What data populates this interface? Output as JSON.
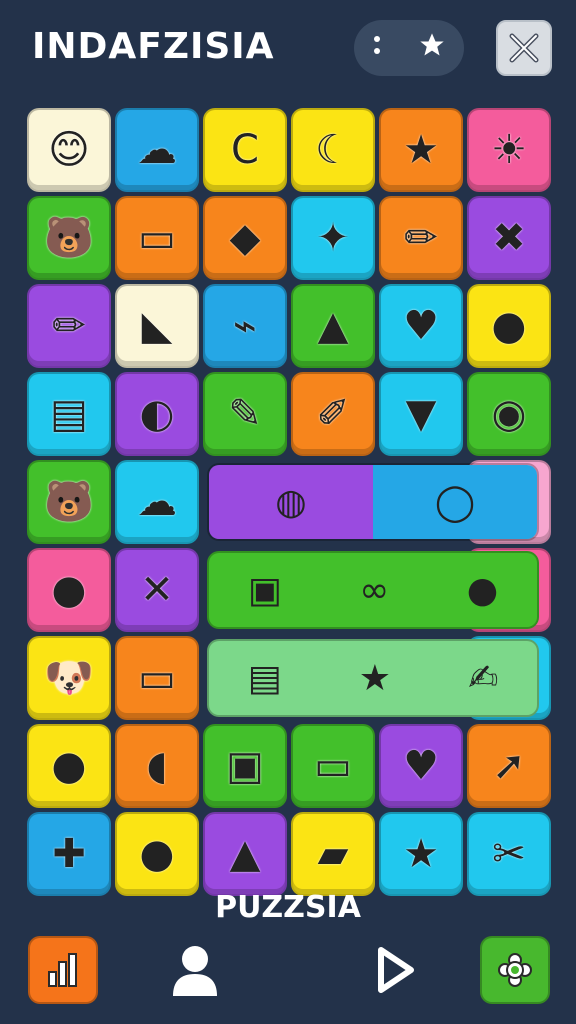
{
  "header": {
    "title": "INDAFZISIA",
    "menu_icon": "more-vertical-icon",
    "star_icon": "star-icon",
    "close_icon": "close-icon"
  },
  "board": {
    "colors": {
      "cream": "#fbf6d8",
      "blue": "#25a7e6",
      "yellow": "#fbe414",
      "orange": "#f7851c",
      "pink": "#f45c9c",
      "green": "#43c02b",
      "purple": "#9a4be0",
      "cyan": "#21c8ee",
      "lightpink": "#f7a6cf",
      "lightgreen": "#7cd88a"
    },
    "tiles": [
      [
        "star-face-icon",
        "cloud-creature-icon",
        "c-hook-icon",
        "crescent-moon-icon",
        "purple-bag-icon",
        "sun-gear-icon"
      ],
      [
        "bear-icon",
        "tablet-icon",
        "box-icon",
        "sun-icon",
        "pencil-icon",
        "tool-kit-icon"
      ],
      [
        "crayon-icon",
        "pink-fish-icon",
        "lighter-icon",
        "slime-icon",
        "speech-heart-icon",
        "bear-face-icon"
      ],
      [
        "trash-can-icon",
        "green-creature-icon",
        "blue-marker-icon",
        "paint-brush-icon",
        "yellow-kite-icon",
        "spiral-icon"
      ],
      [
        "yellow-bear-icon",
        "cloud-face-icon",
        "",
        "",
        "",
        "green-cat-icon"
      ],
      [
        "cookie-icon",
        "crossed-sticks-icon",
        "",
        "",
        "",
        "pencil-icon"
      ],
      [
        "yellow-dog-icon",
        "gamepad-icon",
        "",
        "",
        "",
        "ice-pop-icon"
      ],
      [
        "seal-icon",
        "radish-icon",
        "jar-icon",
        "cake-icon",
        "heart-balloon-icon",
        "comet-icon"
      ],
      [
        "broccoli-icon",
        "red-balloon-icon",
        "rocket-icon",
        "book-icon",
        "star-creature-icon",
        "scissors-icon"
      ]
    ],
    "tile_glyphs": [
      [
        "😊",
        "☁",
        "C",
        "☾",
        "★",
        "☀"
      ],
      [
        "🐻",
        "▭",
        "◆",
        "✦",
        "✏",
        "✖"
      ],
      [
        "✏",
        "◣",
        "⌁",
        "▲",
        "♥",
        "●"
      ],
      [
        "▤",
        "◐",
        "✎",
        "✐",
        "▼",
        "◉"
      ],
      [
        "🐻",
        "☁",
        "",
        "",
        "",
        "●"
      ],
      [
        "●",
        "✕",
        "",
        "",
        "",
        "✏"
      ],
      [
        "🐶",
        "▭",
        "",
        "",
        "",
        "▲"
      ],
      [
        "●",
        "◖",
        "▣",
        "▭",
        "♥",
        "➚"
      ],
      [
        "✚",
        "●",
        "▲",
        "▰",
        "★",
        "✂"
      ]
    ],
    "tile_colors": [
      [
        "cream",
        "blue",
        "yellow",
        "yellow",
        "orange",
        "pink"
      ],
      [
        "green",
        "orange",
        "orange",
        "cyan",
        "orange",
        "purple"
      ],
      [
        "purple",
        "cream",
        "blue",
        "green",
        "cyan",
        "yellow"
      ],
      [
        "cyan",
        "purple",
        "green",
        "orange",
        "cyan",
        "green"
      ],
      [
        "green",
        "cyan",
        "",
        "",
        "",
        "lightpink"
      ],
      [
        "pink",
        "purple",
        "",
        "",
        "",
        "pink"
      ],
      [
        "yellow",
        "orange",
        "",
        "",
        "",
        "cyan"
      ],
      [
        "yellow",
        "orange",
        "green",
        "green",
        "purple",
        "orange"
      ],
      [
        "blue",
        "yellow",
        "purple",
        "yellow",
        "cyan",
        "cyan"
      ]
    ],
    "wide_rows": [
      {
        "left": "purple",
        "right": "blue",
        "items": [
          "ringed-planet-icon",
          "blue-balloon-icon"
        ],
        "glyphs": [
          "◍",
          "◯"
        ]
      },
      {
        "color": "green",
        "items": [
          "red-box-icon",
          "rings-icon",
          "pink-balloon-icon"
        ],
        "glyphs": [
          "▣",
          "∞",
          "●"
        ]
      },
      {
        "color": "lightgreen",
        "items": [
          "flag-icon",
          "red-star-icon",
          "check-note-icon"
        ],
        "glyphs": [
          "▤",
          "★",
          "✍"
        ]
      }
    ]
  },
  "footer": {
    "label": "PUZZSIA"
  },
  "nav": [
    {
      "name": "stats-button",
      "icon": "bar-chart-icon",
      "color": "#f5741a"
    },
    {
      "name": "profile-button",
      "icon": "user-icon",
      "color": ""
    },
    {
      "name": "play-button",
      "icon": "play-icon",
      "color": ""
    },
    {
      "name": "settings-button",
      "icon": "gear-icon",
      "color": "#48b82e"
    }
  ]
}
